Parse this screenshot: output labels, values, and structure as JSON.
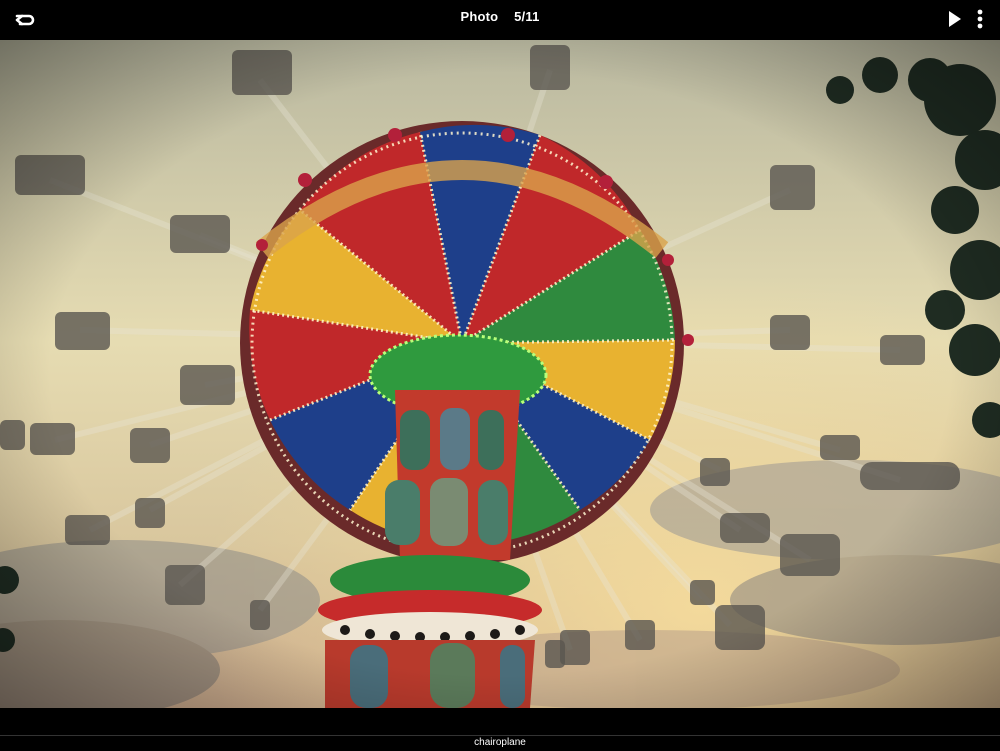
{
  "header": {
    "title": "Photo",
    "counter": "5/11",
    "back_icon": "back-arrow-icon",
    "play_icon": "play-icon",
    "more_icon": "more-vertical-icon"
  },
  "photo": {
    "subject": "swing ride",
    "colors": {
      "sky_top": "#c9c6a8",
      "sky_mid": "#e8dcae",
      "sky_glow": "#f2d58e",
      "canopy_red": "#c0282a",
      "canopy_blue": "#1e3f8a",
      "canopy_green": "#2f8a3e",
      "canopy_yellow": "#e8b230"
    }
  },
  "caption": "chairoplane"
}
